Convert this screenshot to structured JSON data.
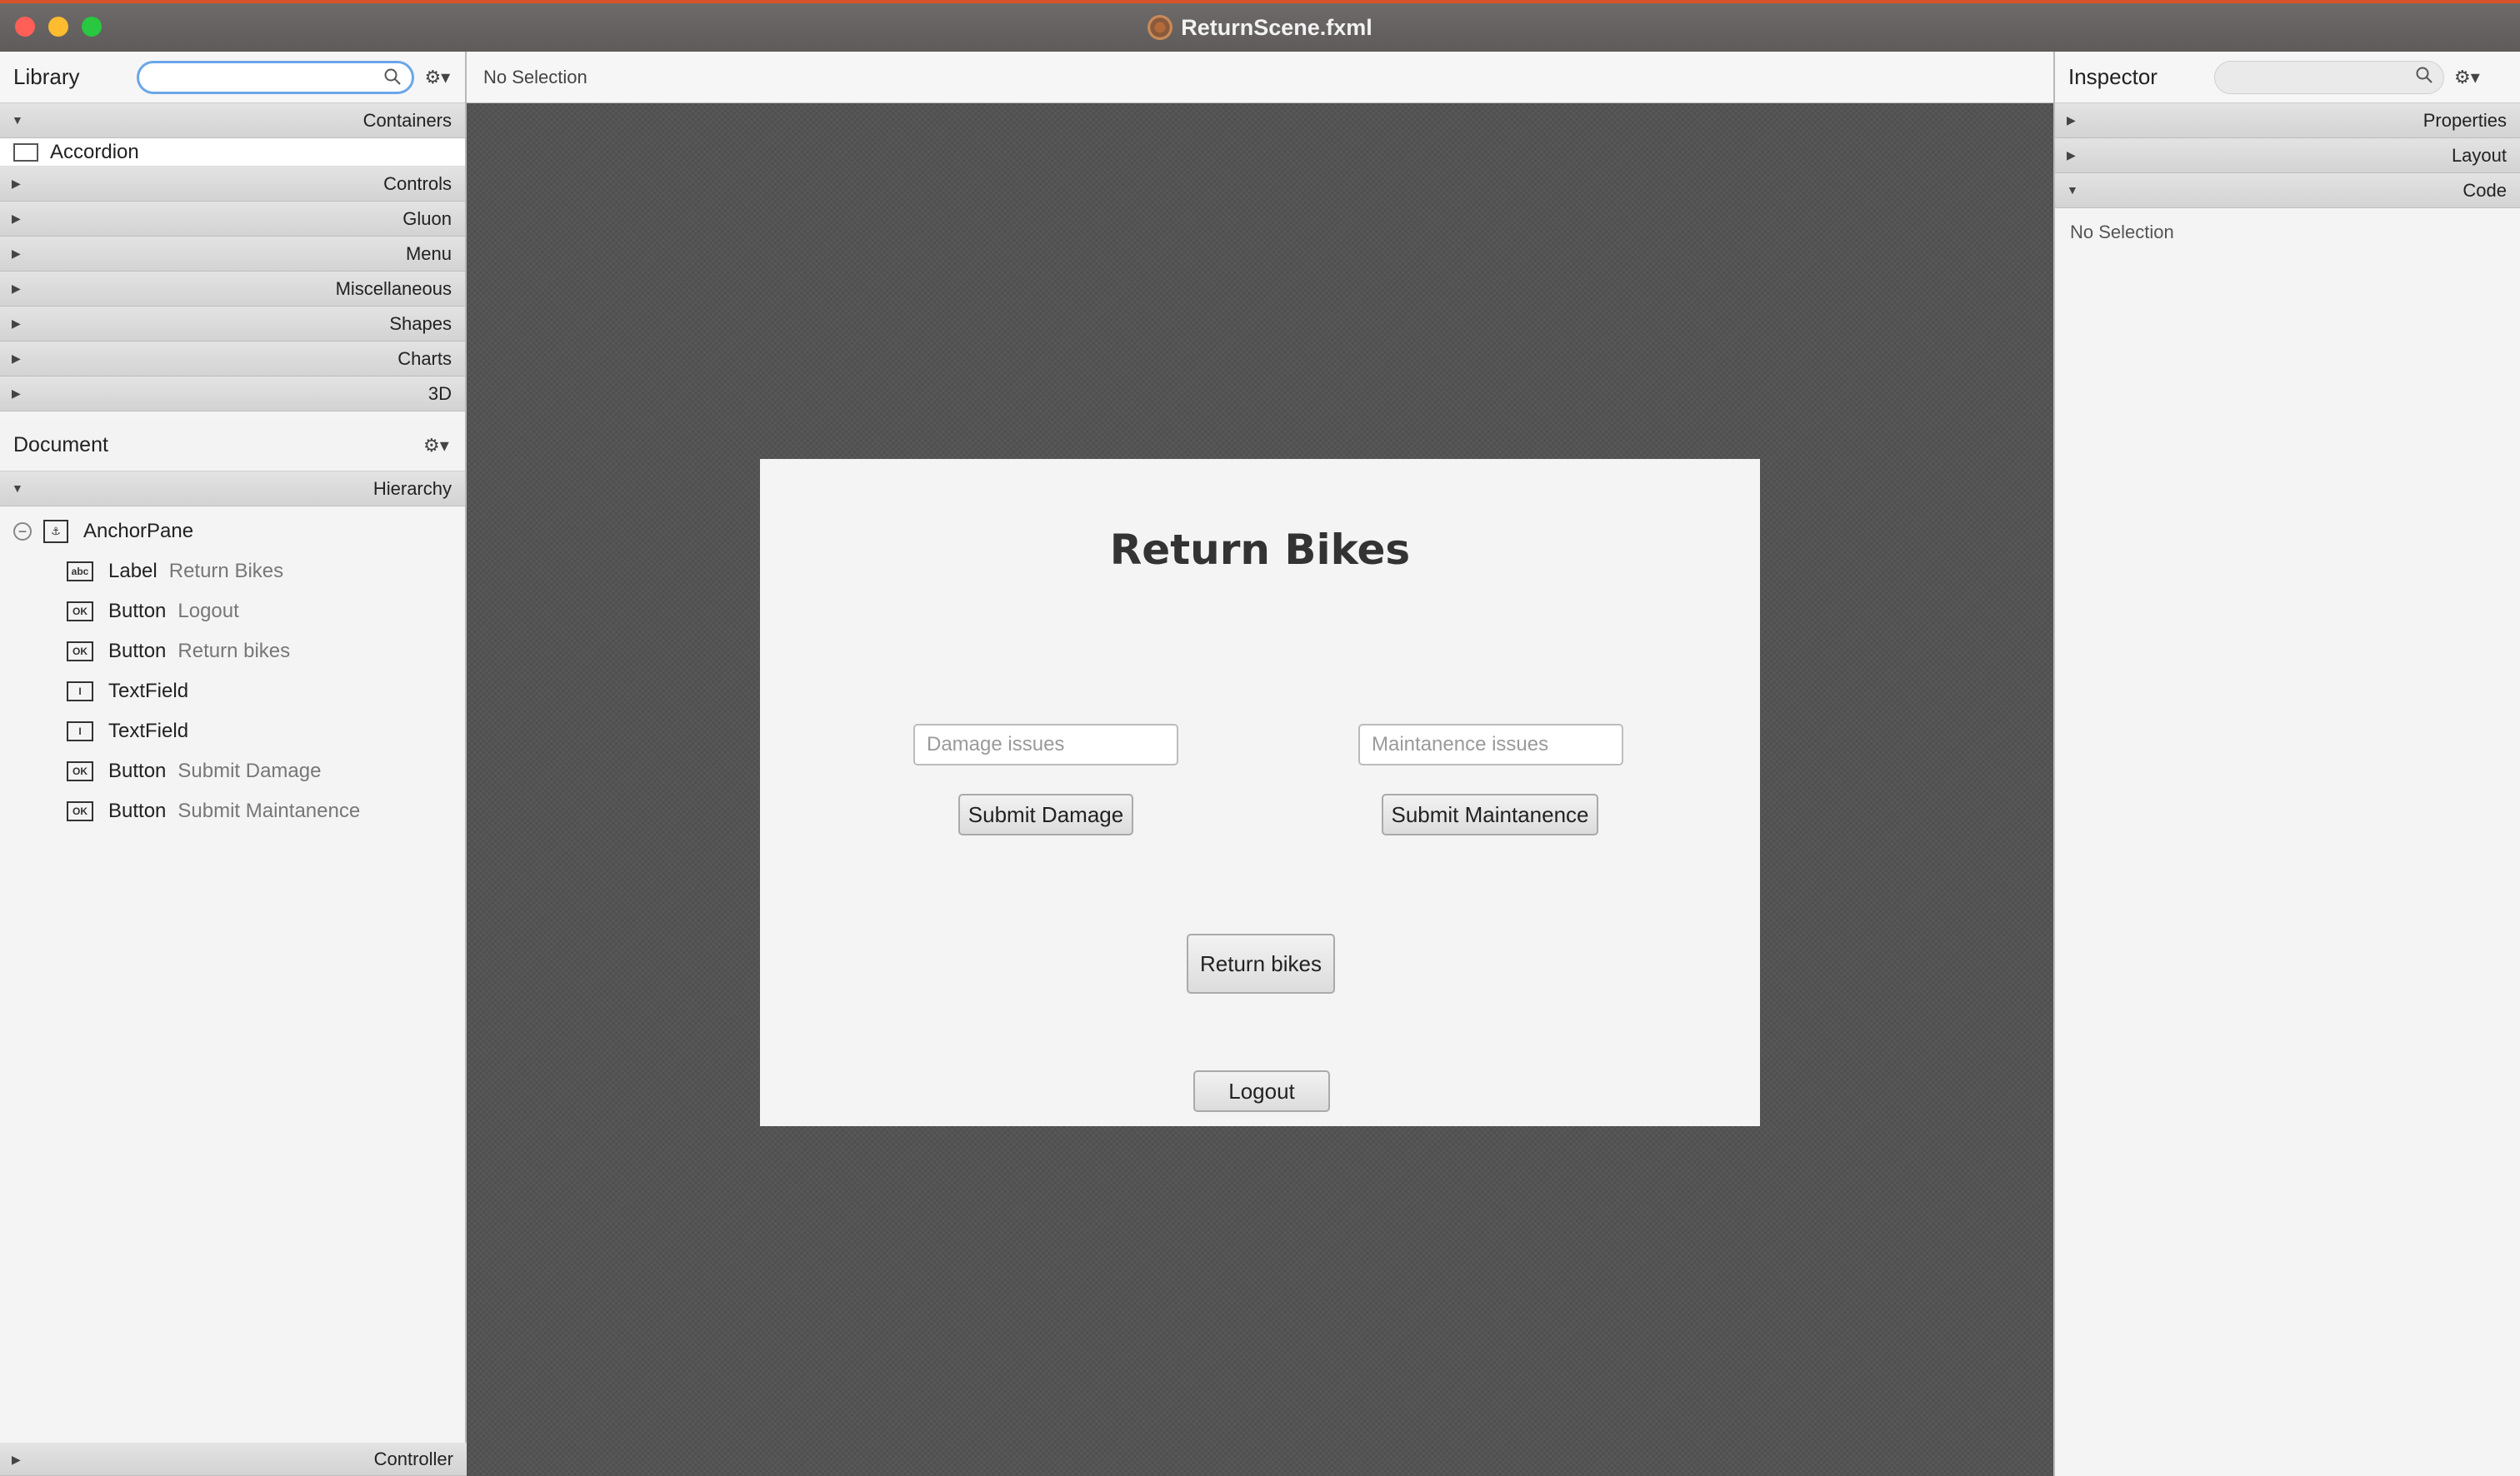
{
  "window": {
    "title": "ReturnScene.fxml"
  },
  "library": {
    "title": "Library",
    "search_value": "",
    "sections": [
      {
        "label": "Containers",
        "expanded": true
      },
      {
        "label": "Controls",
        "expanded": false
      },
      {
        "label": "Gluon",
        "expanded": false
      },
      {
        "label": "Menu",
        "expanded": false
      },
      {
        "label": "Miscellaneous",
        "expanded": false
      },
      {
        "label": "Shapes",
        "expanded": false
      },
      {
        "label": "Charts",
        "expanded": false
      },
      {
        "label": "3D",
        "expanded": false
      }
    ],
    "container_items": [
      "Accordion"
    ]
  },
  "document": {
    "title": "Document",
    "hierarchy_label": "Hierarchy",
    "root": "AnchorPane",
    "nodes": [
      {
        "icon": "abc",
        "type": "Label",
        "text": "Return Bikes"
      },
      {
        "icon": "OK",
        "type": "Button",
        "text": "Logout"
      },
      {
        "icon": "OK",
        "type": "Button",
        "text": "Return bikes"
      },
      {
        "icon": "I",
        "type": "TextField",
        "text": ""
      },
      {
        "icon": "I",
        "type": "TextField",
        "text": ""
      },
      {
        "icon": "OK",
        "type": "Button",
        "text": "Submit Damage"
      },
      {
        "icon": "OK",
        "type": "Button",
        "text": "Submit Maintanence"
      }
    ],
    "controller_label": "Controller"
  },
  "center": {
    "breadcrumb": "No Selection",
    "scene": {
      "title": "Return Bikes",
      "damage_placeholder": "Damage issues",
      "maintenance_placeholder": "Maintanence issues",
      "submit_damage": "Submit Damage",
      "submit_maintenance": "Submit Maintanence",
      "return_bikes": "Return bikes",
      "logout": "Logout"
    }
  },
  "inspector": {
    "title": "Inspector",
    "sections": [
      {
        "label": "Properties",
        "expanded": false
      },
      {
        "label": "Layout",
        "expanded": false
      },
      {
        "label": "Code",
        "expanded": true
      }
    ],
    "body_text": "No Selection"
  },
  "colors": {
    "titlebar": "#625e5d",
    "canvas_bg": "#545454",
    "search_focus": "#6aa6e8"
  }
}
